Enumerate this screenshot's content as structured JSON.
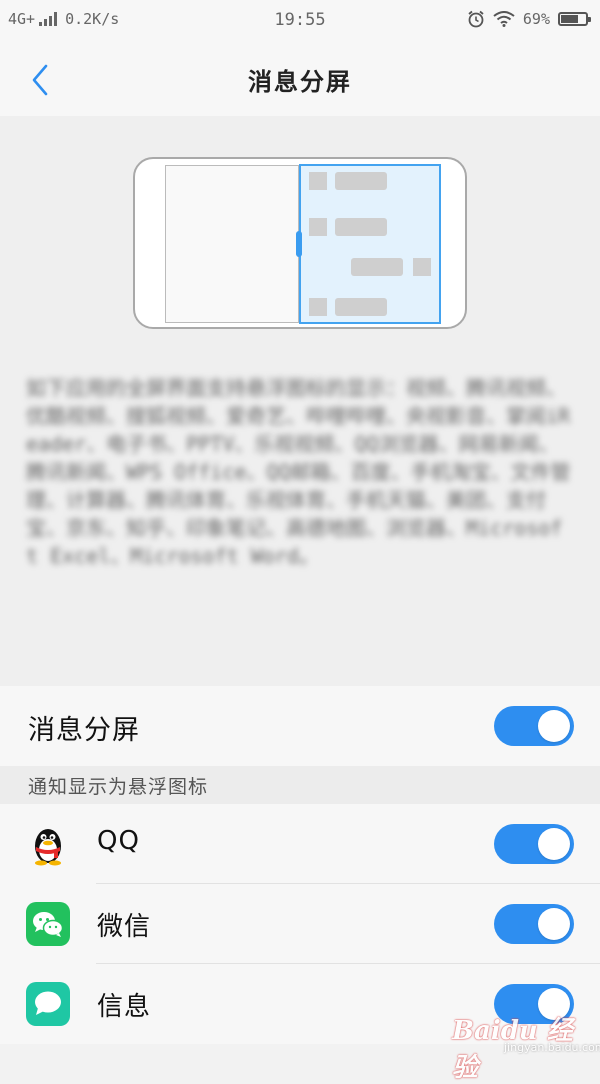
{
  "status_bar": {
    "network": "4G+",
    "speed": "0.2K/s",
    "time": "19:55",
    "battery": "69%",
    "battery_level": 0.69
  },
  "header": {
    "title": "消息分屏"
  },
  "preview": {
    "description": "如下应用的全屏界面支持悬浮图标的显示：视频、腾讯视频、优酷视频、搜狐视频、爱奇艺、哔哩哔哩、央视影音、掌阅iReader、电子书、PPTV、乐视视频、QQ浏览器、网易新闻、腾讯新闻、WPS Office、QQ邮箱、百度、手机淘宝、文件管理、计算器、腾讯体育、乐视体育、手机天猫、美团、支付宝、京东、知乎、印象笔记、高德地图、浏览器、Microsoft Excel、Microsoft Word。"
  },
  "master": {
    "label": "消息分屏",
    "enabled": true
  },
  "section": {
    "label": "通知显示为悬浮图标"
  },
  "apps": [
    {
      "label": "QQ",
      "icon": "qq-penguin-icon",
      "enabled": true
    },
    {
      "label": "微信",
      "icon": "wechat-icon",
      "enabled": true
    },
    {
      "label": "信息",
      "icon": "messages-icon",
      "enabled": true
    }
  ],
  "watermark": {
    "text": "Baidu 经验",
    "sub": "jingyan.baidu.com"
  },
  "colors": {
    "accent": "#2e8ef0",
    "wechat": "#22c15e",
    "messages": "#1fc7a4"
  }
}
